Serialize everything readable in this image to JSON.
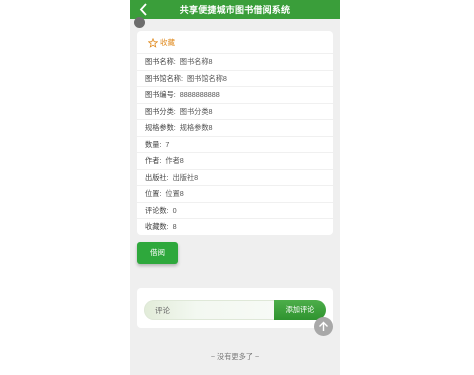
{
  "header": {
    "title": "共享便捷城市图书借阅系统",
    "back_icon": "chevron-left-icon"
  },
  "book": {
    "favorite_label": "收藏",
    "favorite_icon": "star-outline-icon",
    "rows": [
      {
        "label": "图书名称:",
        "value": "图书名称8"
      },
      {
        "label": "图书馆名称:",
        "value": "图书馆名称8"
      },
      {
        "label": "图书编号:",
        "value": "8888888888"
      },
      {
        "label": "图书分类:",
        "value": "图书分类8"
      },
      {
        "label": "规格参数:",
        "value": "规格参数8"
      },
      {
        "label": "数量:",
        "value": "7"
      },
      {
        "label": "作者:",
        "value": "作者8"
      },
      {
        "label": "出版社:",
        "value": "出版社8"
      },
      {
        "label": "位置:",
        "value": "位置8"
      },
      {
        "label": "评论数:",
        "value": "0"
      },
      {
        "label": "收藏数:",
        "value": "8"
      }
    ]
  },
  "actions": {
    "borrow_label": "借阅"
  },
  "comment": {
    "placeholder": "评论",
    "submit_label": "添加评论"
  },
  "footer": {
    "end_text": "~ 没有更多了 ~"
  },
  "colors": {
    "header_bg": "#3a9e3a",
    "favorite": "#e08a1e",
    "button_green": "#2ea83c"
  }
}
